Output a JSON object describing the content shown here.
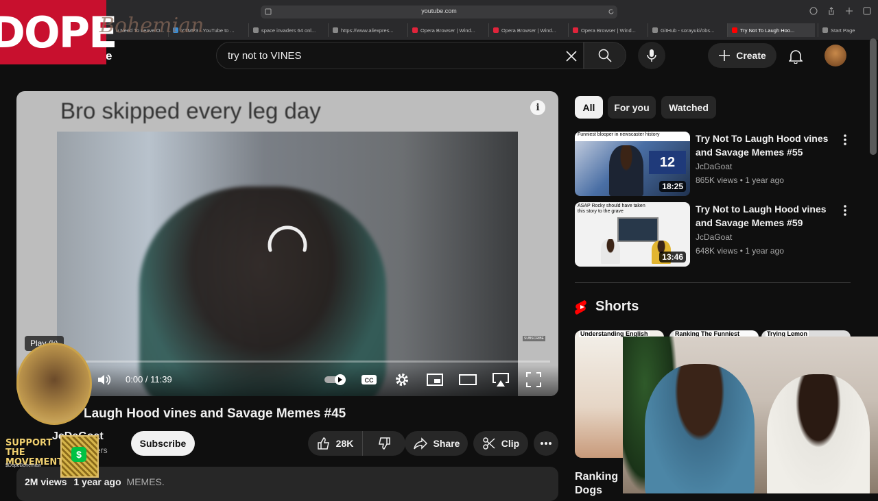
{
  "browser": {
    "url": "youtube.com",
    "tabs": [
      {
        "label": "u Need To Leave O...",
        "color": "#c33"
      },
      {
        "label": "YTMP3 - YouTube to ...",
        "color": "#3a8fd8"
      },
      {
        "label": "space invaders 64 onl...",
        "color": "#888"
      },
      {
        "label": "https://www.aliexpres...",
        "color": "#888"
      },
      {
        "label": "Opera Browser | Wind...",
        "color": "#e0243b"
      },
      {
        "label": "Opera Browser | Wind...",
        "color": "#e0243b"
      },
      {
        "label": "Opera Browser | Wind...",
        "color": "#e0243b"
      },
      {
        "label": "GitHub - sorayuki/obs...",
        "color": "#888"
      },
      {
        "label": "Try Not To Laugh Hoo...",
        "color": "#ff0000"
      },
      {
        "label": "Start Page",
        "color": "#888"
      }
    ]
  },
  "overlay": {
    "dope": "DOPE",
    "dope_script": "Bohemian",
    "support_text": "SUPPORT THE MOVEMENT",
    "support_handle": "$DopeBohemian",
    "cash_symbol": "$"
  },
  "header": {
    "logo_partial": "e",
    "search_value": "try not to VINES",
    "create_label": "Create"
  },
  "player": {
    "caption": "Bro skipped every leg day",
    "time": "0:00 / 11:39",
    "tooltip": "Play (k)",
    "watermark": "SUBSCRIBE",
    "progress": 0
  },
  "video": {
    "title": "Laugh Hood vines and Savage Memes #45",
    "channel": "JcDaGoat",
    "subscribers": "ers",
    "subscribe_label": "Subscribe",
    "likes": "28K",
    "share_label": "Share",
    "clip_label": "Clip",
    "views": "2M views",
    "age": "1 year ago",
    "tag": "MEMES."
  },
  "sidebar": {
    "chips": [
      "All",
      "For you",
      "Watched"
    ],
    "recommendations": [
      {
        "title": "Try Not To Laugh Hood vines and Savage Memes #55",
        "channel": "JcDaGoat",
        "meta": "865K views • 1 year ago",
        "duration": "18:25",
        "thumb_caption": "Funniest blooper in newscaster history"
      },
      {
        "title": "Try Not to Laugh Hood vines and Savage Memes #59",
        "channel": "JcDaGoat",
        "meta": "648K views • 1 year ago",
        "duration": "13:46",
        "thumb_caption": "ASAP Rocky should have taken this story to the grave"
      }
    ],
    "shorts_heading": "Shorts",
    "shorts": [
      {
        "title": "Understanding English"
      },
      {
        "title": "Ranking The Funniest Jumpscares"
      },
      {
        "title": "Trying Lemon"
      }
    ],
    "short_label_line1": "Ranking",
    "short_label_line2": "Dogs"
  }
}
